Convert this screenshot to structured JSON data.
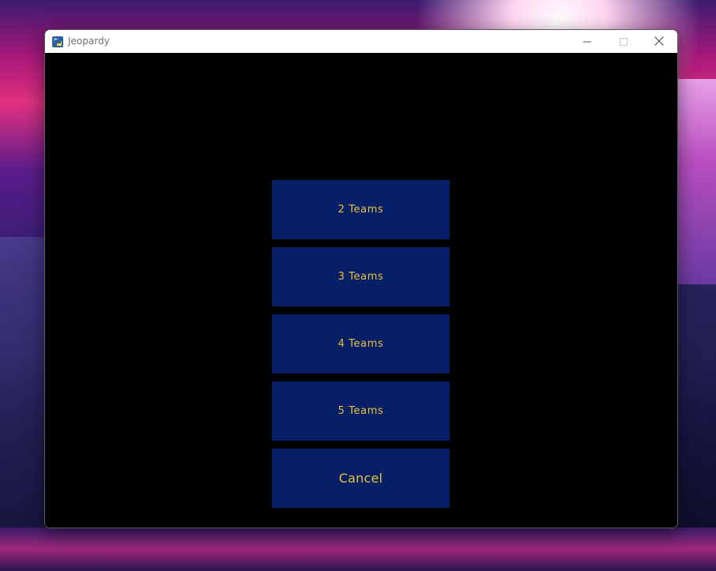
{
  "window": {
    "title": "Jeopardy",
    "app_icon": "python-icon"
  },
  "controls": {
    "minimize_icon": "minimize-icon",
    "maximize_icon": "maximize-icon",
    "close_icon": "close-icon"
  },
  "menu": {
    "buttons": [
      {
        "label": "2 Teams"
      },
      {
        "label": "3 Teams"
      },
      {
        "label": "4 Teams"
      },
      {
        "label": "5 Teams"
      },
      {
        "label": "Cancel"
      }
    ]
  },
  "colors": {
    "background": "#000000",
    "button_bg": "#061f66",
    "button_text": "#e8c23c"
  }
}
